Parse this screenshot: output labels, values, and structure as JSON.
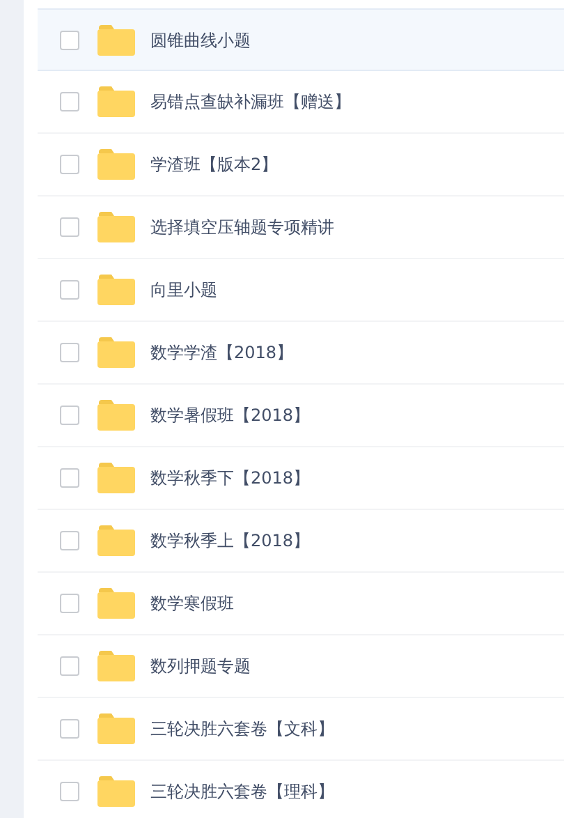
{
  "folders": [
    {
      "name": "圆锥曲线小题",
      "selected": true,
      "checked": false
    },
    {
      "name": "易错点查缺补漏班【赠送】",
      "selected": false,
      "checked": false
    },
    {
      "name": "学渣班【版本2】",
      "selected": false,
      "checked": false
    },
    {
      "name": "选择填空压轴题专项精讲",
      "selected": false,
      "checked": false
    },
    {
      "name": "向里小题",
      "selected": false,
      "checked": false
    },
    {
      "name": "数学学渣【2018】",
      "selected": false,
      "checked": false
    },
    {
      "name": "数学暑假班【2018】",
      "selected": false,
      "checked": false
    },
    {
      "name": "数学秋季下【2018】",
      "selected": false,
      "checked": false
    },
    {
      "name": "数学秋季上【2018】",
      "selected": false,
      "checked": false
    },
    {
      "name": "数学寒假班",
      "selected": false,
      "checked": false
    },
    {
      "name": "数列押题专题",
      "selected": false,
      "checked": false
    },
    {
      "name": "三轮决胜六套卷【文科】",
      "selected": false,
      "checked": false
    },
    {
      "name": "三轮决胜六套卷【理科】",
      "selected": false,
      "checked": false
    }
  ]
}
